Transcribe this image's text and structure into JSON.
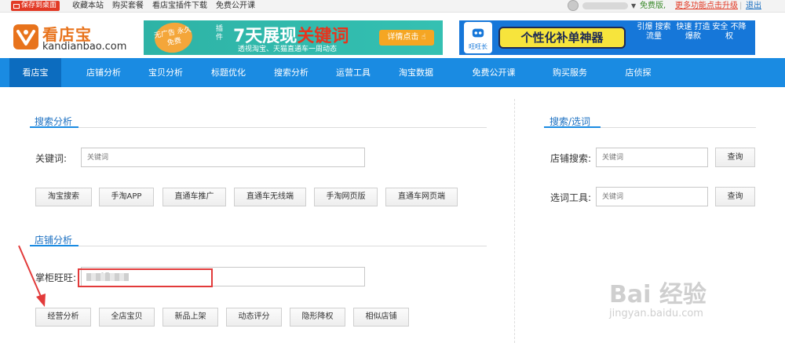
{
  "topbar": {
    "save_label": "保存到桌面",
    "links": [
      "收藏本站",
      "购买套餐",
      "看店宝插件下载",
      "免费公开课"
    ],
    "free_version": "免费版,",
    "upgrade": "更多功能点击升级",
    "logout": "退出"
  },
  "logo": {
    "name": "看店宝",
    "url": "kandianbao.com"
  },
  "ad1": {
    "badge": "无广告 永久免费",
    "plugin": "插件",
    "headline_a": "7天展现",
    "headline_b": "关键词",
    "subline": "透视淘宝、天猫直通车一周动态",
    "cta": "详情点击"
  },
  "ad2": {
    "brand": "旺旺长",
    "pill": "个性化补单神器",
    "t1": "引爆 搜索 流量",
    "t2": "快速 打造 爆款",
    "t3": "安全 不降权"
  },
  "nav": [
    "看店宝",
    "店铺分析",
    "宝贝分析",
    "标题优化",
    "搜索分析",
    "运营工具",
    "淘宝数据",
    "免费公开课",
    "购买服务",
    "店侦探"
  ],
  "search_section": {
    "title": "搜索分析",
    "keyword_label": "关键词:",
    "keyword_placeholder": "关键词",
    "buttons": [
      "淘宝搜索",
      "手淘APP",
      "直通车推广",
      "直通车无线端",
      "手淘网页版",
      "直通车网页端"
    ]
  },
  "shop_section": {
    "title": "店铺分析",
    "seller_label": "掌柜旺旺:",
    "seller_value": "17",
    "buttons": [
      "经营分析",
      "全店宝贝",
      "新品上架",
      "动态评分",
      "隐形降权",
      "相似店铺"
    ]
  },
  "right_section": {
    "title": "搜索/选词",
    "shop_search_label": "店铺搜索:",
    "shop_search_placeholder": "关键词",
    "shop_search_button": "查询",
    "word_tool_label": "选词工具:",
    "word_tool_placeholder": "关键词",
    "word_tool_button": "查询"
  },
  "watermark": {
    "logo": "Bai 经验",
    "url": "jingyan.baidu.com"
  },
  "colors": {
    "nav_blue": "#1a8be2",
    "accent_orange": "#e8731c",
    "alert_red": "#e23a26"
  }
}
